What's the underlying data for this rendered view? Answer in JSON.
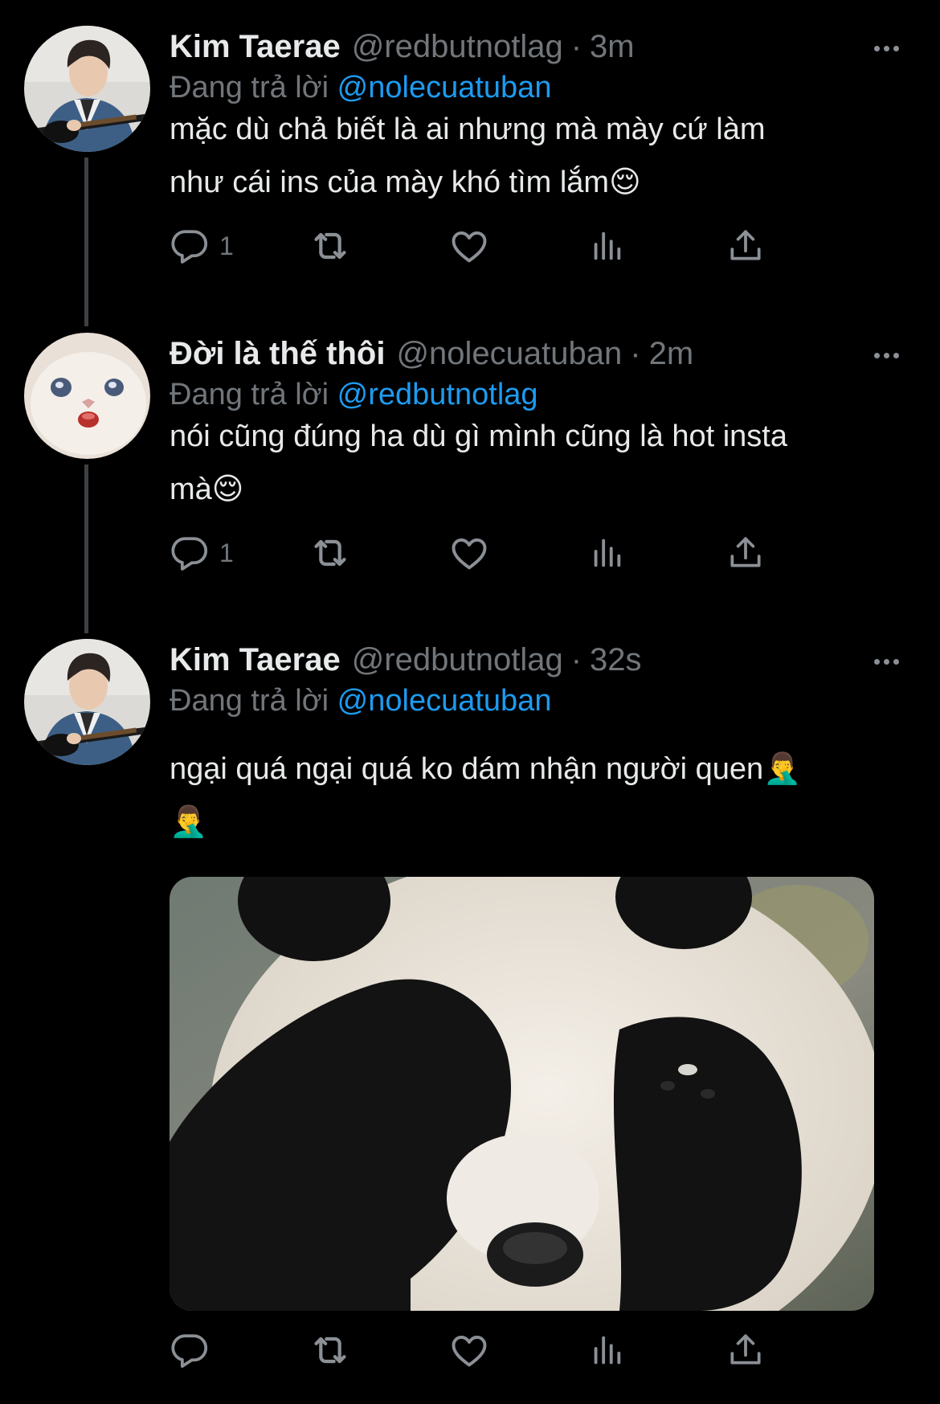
{
  "tweets": [
    {
      "name": "Kim Taerae",
      "handle": "@redbutnotlag",
      "time": "3m",
      "reply_prefix": "Đang trả lời",
      "reply_to": "@nolecuatuban",
      "lines": [
        "mặc dù chả biết là ai nhưng mà mày cứ làm",
        "như cái ins của mày khó tìm lắm😌"
      ],
      "reply_count": "1",
      "avatar": "guitar-boy"
    },
    {
      "name": "Đời là thế thôi",
      "handle": "@nolecuatuban",
      "time": "2m",
      "reply_prefix": "Đang trả lời",
      "reply_to": "@redbutnotlag",
      "lines": [
        "nói cũng đúng ha dù gì mình cũng là hot insta",
        "mà😌"
      ],
      "reply_count": "1",
      "avatar": "white-cat"
    },
    {
      "name": "Kim Taerae",
      "handle": "@redbutnotlag",
      "time": "32s",
      "reply_prefix": "Đang trả lời",
      "reply_to": "@nolecuatuban",
      "lines": [
        "ngại quá ngại quá ko dám nhận người quen🤦‍♂️",
        "🤦‍♂️"
      ],
      "reply_count": "",
      "avatar": "guitar-boy",
      "media": "panda-covering-eyes"
    }
  ],
  "colors": {
    "background": "#000000",
    "text": "#e7e9ea",
    "muted": "#71767b",
    "link": "#1d9bf0",
    "icon": "#8b9096",
    "thread_line": "#3e4144"
  },
  "icons": [
    "reply-icon",
    "retweet-icon",
    "like-icon",
    "views-icon",
    "share-icon",
    "more-icon"
  ]
}
